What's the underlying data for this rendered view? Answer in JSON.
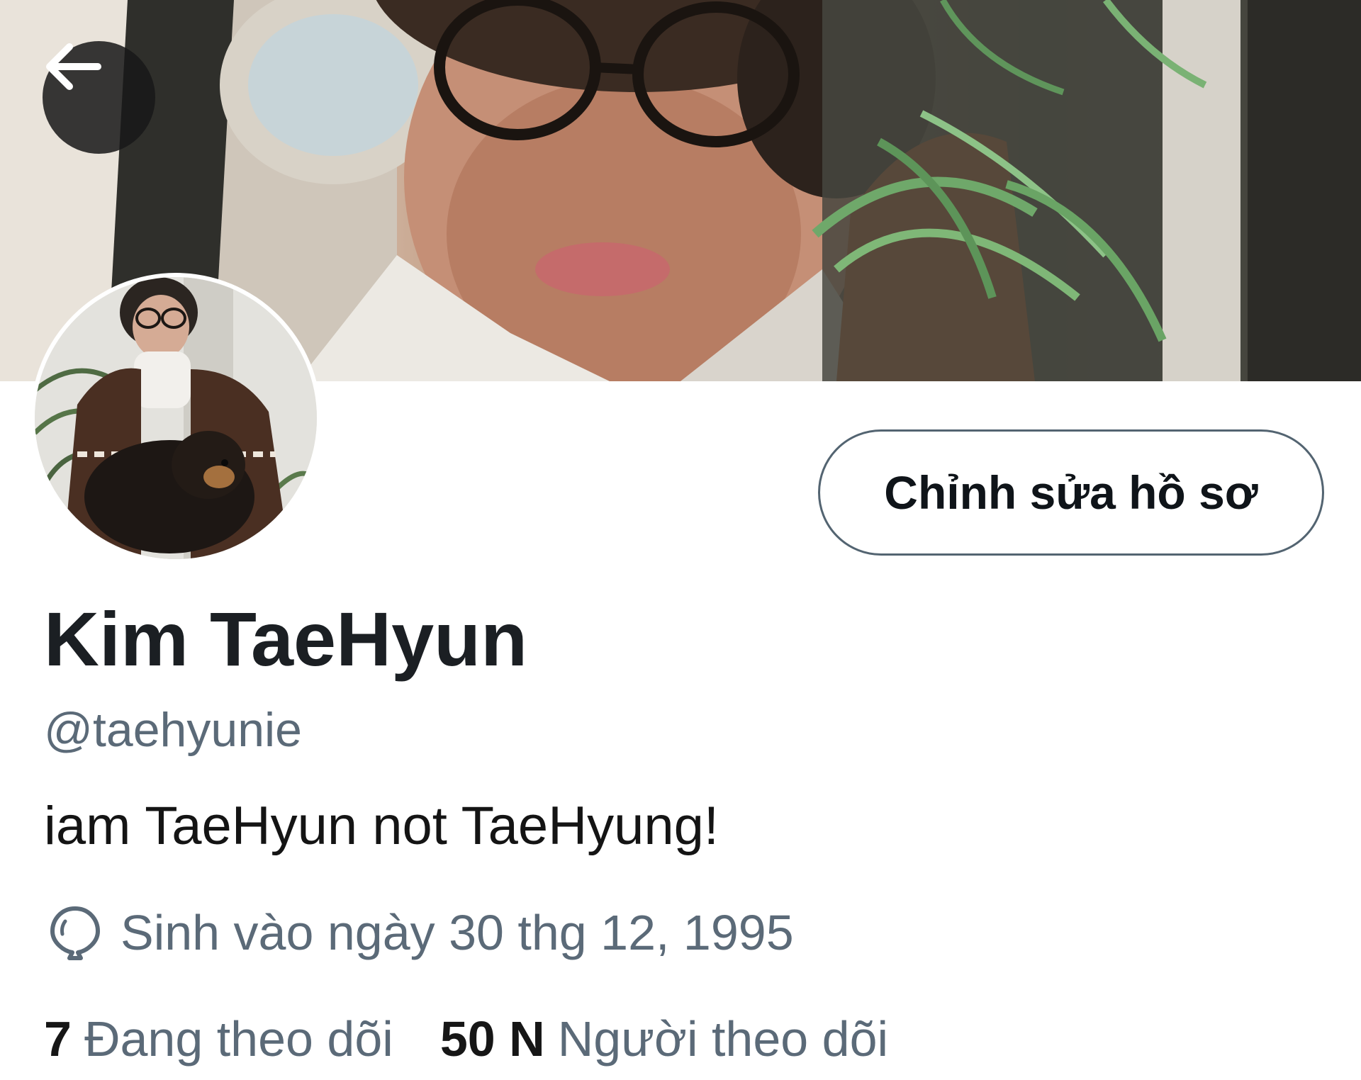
{
  "header": {
    "back_icon": "arrow-left-icon"
  },
  "profile": {
    "display_name": "Kim TaeHyun",
    "handle": "@taehyunie",
    "bio": "iam TaeHyun not TaeHyung!",
    "birth_icon": "balloon-icon",
    "birth_text": "Sinh vào ngày 30 thg 12, 1995",
    "edit_button_label": "Chỉnh sửa hồ sơ",
    "following_count": "7",
    "following_label": "Đang theo dõi",
    "followers_count": "50 N",
    "followers_label": "Người theo dõi"
  },
  "colors": {
    "primary_text": "#0f1419",
    "secondary_text": "#5b6a78",
    "button_border": "#536471",
    "back_button_bg": "#181818"
  }
}
